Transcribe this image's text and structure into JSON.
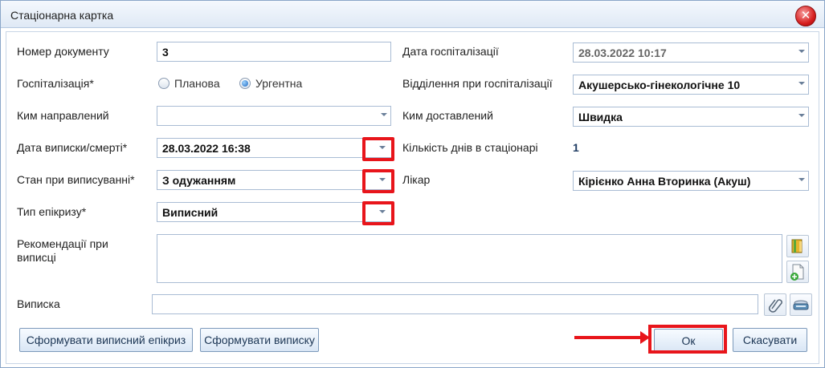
{
  "window": {
    "title": "Стаціонарна картка",
    "close_symbol": "✕"
  },
  "form": {
    "doc_number": {
      "label": "Номер документу",
      "value": "3"
    },
    "hospitalization_date": {
      "label": "Дата госпіталізації",
      "value": "28.03.2022 10:17"
    },
    "hospitalization": {
      "label": "Госпіталізація*",
      "options": [
        "Планова",
        "Ургентна"
      ],
      "selected": "Ургентна"
    },
    "department": {
      "label": "Відділення при госпіталізації",
      "value": "Акушерсько-гінекологічне 10"
    },
    "referred_by": {
      "label": "Ким направлений",
      "value": ""
    },
    "delivered_by": {
      "label": "Ким доставлений",
      "value": "Швидка"
    },
    "discharge_date": {
      "label": "Дата виписки/смерті*",
      "value": "28.03.2022 16:38"
    },
    "days_in_hospital": {
      "label": "Кількість днів в стаціонарі",
      "value": "1"
    },
    "discharge_state": {
      "label": "Стан при виписуванні*",
      "value": "З одужанням"
    },
    "doctor": {
      "label": "Лікар",
      "value": "Кірієнко Анна Вторинка (Акуш)"
    },
    "epicrisis_type": {
      "label": "Тип епікризу*",
      "value": "Виписний"
    },
    "recommendations": {
      "label": "Рекомендації при виписці",
      "value": ""
    },
    "extract": {
      "label": "Виписка",
      "value": ""
    }
  },
  "buttons": {
    "form_epicrisis": "Сформувати виписний епікриз",
    "form_extract": "Сформувати виписку",
    "ok": "Ок",
    "cancel": "Скасувати"
  },
  "colors": {
    "highlight": "#e8151b",
    "accent": "#1a66c0"
  }
}
